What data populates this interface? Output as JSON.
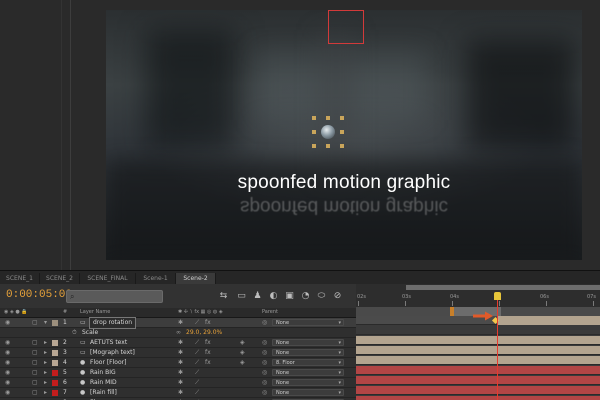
{
  "viewer": {
    "title_text": "spoonfed motion graphic",
    "reflection_text": "spoonfed motion graphic"
  },
  "tabs": [
    "SCENE_1",
    "SCENE_2",
    "SCENE_FINAL",
    "Scene-1",
    "Scene-2"
  ],
  "active_tab": "Scene-2",
  "toolbar": {
    "timecode": "0:00:05:00",
    "search_placeholder": "",
    "search_icon": "search-icon",
    "icons": [
      "composition-mini-flowchart-icon",
      "draft-3d-icon",
      "solo-icon",
      "motion-blur-icon",
      "frame-blend-icon",
      "graph-editor-icon",
      "brainstorm-icon"
    ]
  },
  "columns": {
    "num": "#",
    "layer_name": "Layer Name",
    "parent": "Parent"
  },
  "layers": [
    {
      "num": "1",
      "name": "drop rotation",
      "color": "#9c8f7d",
      "parent": "None",
      "expanded": true,
      "selected": true,
      "bracket": true
    },
    {
      "num": "",
      "name": "Scale",
      "property": true,
      "value": "29.0, 29.0%",
      "parent": ""
    },
    {
      "num": "2",
      "name": "AETUTS text",
      "color": "#b8a794",
      "parent": "None",
      "bracket": true,
      "threeD": true
    },
    {
      "num": "3",
      "name": "[Mograph text]",
      "color": "#b8a794",
      "parent": "None",
      "bracket": true,
      "threeD": true
    },
    {
      "num": "4",
      "name": "Floor [Floor]",
      "color": "#b8a794",
      "parent": "8. Floor",
      "bracket": false,
      "threeD": true
    },
    {
      "num": "5",
      "name": "Rain BIG",
      "color": "#c21d1d",
      "parent": "None"
    },
    {
      "num": "6",
      "name": "Rain MID",
      "color": "#c21d1d",
      "parent": "None"
    },
    {
      "num": "7",
      "name": "[Rain fill]",
      "color": "#c21d1d",
      "parent": "None"
    },
    {
      "num": "8",
      "name": "Floor",
      "color": "#ffffff",
      "parent": "None"
    }
  ],
  "timeline": {
    "ruler_labels": [
      "02s",
      "03s",
      "04s",
      "05s",
      "06s",
      "07s"
    ],
    "ruler_labels_shown": [
      "0:2s",
      "02s",
      "04s",
      "",
      "06s",
      "07s"
    ],
    "current_time_sec": 5,
    "track_colors": [
      "#4b4b4b",
      "#3a3a3a",
      "#b3a48f",
      "#b3a48f",
      "#b3a48f",
      "#b24545",
      "#b24545",
      "#b24545",
      "#b24545"
    ]
  },
  "colors": {
    "timecode": "#e7a23a",
    "cti": "#e63b2e",
    "accent_orange": "#e05a2a"
  }
}
